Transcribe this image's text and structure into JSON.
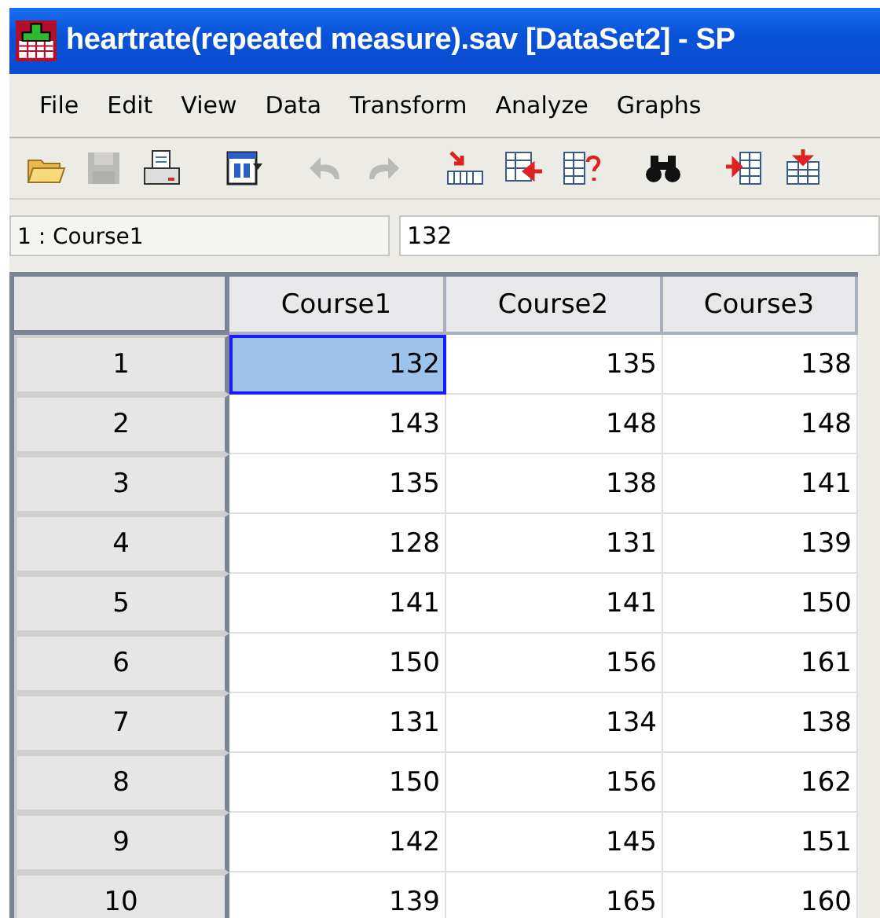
{
  "window": {
    "title": "heartrate(repeated measure).sav [DataSet2] - SP"
  },
  "menu": [
    "File",
    "Edit",
    "View",
    "Data",
    "Transform",
    "Analyze",
    "Graphs"
  ],
  "toolbar": [
    {
      "kind": "open",
      "disabled": false
    },
    {
      "kind": "save",
      "disabled": true
    },
    {
      "kind": "print",
      "disabled": false
    },
    {
      "kind": "dialog",
      "disabled": false
    },
    {
      "kind": "undo",
      "disabled": true
    },
    {
      "kind": "redo",
      "disabled": true
    },
    {
      "kind": "gotocase",
      "disabled": false
    },
    {
      "kind": "gotovar",
      "disabled": false
    },
    {
      "kind": "variables",
      "disabled": false
    },
    {
      "kind": "find",
      "disabled": false
    },
    {
      "kind": "insertcase",
      "disabled": false
    },
    {
      "kind": "insertvar",
      "disabled": false
    }
  ],
  "cell_editor": {
    "cell_ref": "1 : Course1",
    "value": "132"
  },
  "table": {
    "columns": [
      "Course1",
      "Course2",
      "Course3"
    ],
    "rows": [
      {
        "label": "1",
        "cells": [
          "132",
          "135",
          "138"
        ],
        "selected": [
          true,
          false,
          false
        ]
      },
      {
        "label": "2",
        "cells": [
          "143",
          "148",
          "148"
        ],
        "selected": [
          false,
          false,
          false
        ]
      },
      {
        "label": "3",
        "cells": [
          "135",
          "138",
          "141"
        ],
        "selected": [
          false,
          false,
          false
        ]
      },
      {
        "label": "4",
        "cells": [
          "128",
          "131",
          "139"
        ],
        "selected": [
          false,
          false,
          false
        ]
      },
      {
        "label": "5",
        "cells": [
          "141",
          "141",
          "150"
        ],
        "selected": [
          false,
          false,
          false
        ]
      },
      {
        "label": "6",
        "cells": [
          "150",
          "156",
          "161"
        ],
        "selected": [
          false,
          false,
          false
        ]
      },
      {
        "label": "7",
        "cells": [
          "131",
          "134",
          "138"
        ],
        "selected": [
          false,
          false,
          false
        ]
      },
      {
        "label": "8",
        "cells": [
          "150",
          "156",
          "162"
        ],
        "selected": [
          false,
          false,
          false
        ]
      },
      {
        "label": "9",
        "cells": [
          "142",
          "145",
          "151"
        ],
        "selected": [
          false,
          false,
          false
        ]
      },
      {
        "label": "10",
        "cells": [
          "139",
          "165",
          "160"
        ],
        "selected": [
          false,
          false,
          false
        ]
      }
    ]
  }
}
